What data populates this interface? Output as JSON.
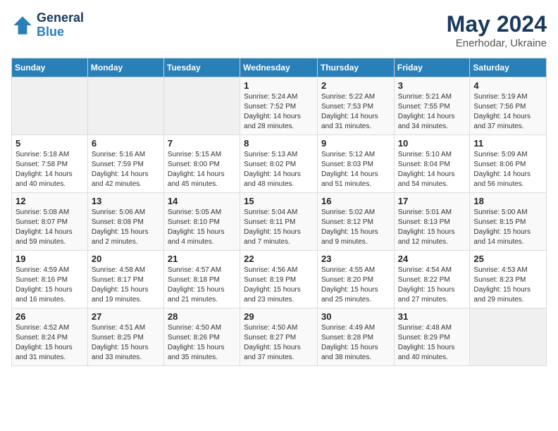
{
  "header": {
    "logo_line1": "General",
    "logo_line2": "Blue",
    "month": "May 2024",
    "location": "Enerhodar, Ukraine"
  },
  "weekdays": [
    "Sunday",
    "Monday",
    "Tuesday",
    "Wednesday",
    "Thursday",
    "Friday",
    "Saturday"
  ],
  "weeks": [
    [
      {
        "day": "",
        "info": ""
      },
      {
        "day": "",
        "info": ""
      },
      {
        "day": "",
        "info": ""
      },
      {
        "day": "1",
        "info": "Sunrise: 5:24 AM\nSunset: 7:52 PM\nDaylight: 14 hours and 28 minutes."
      },
      {
        "day": "2",
        "info": "Sunrise: 5:22 AM\nSunset: 7:53 PM\nDaylight: 14 hours and 31 minutes."
      },
      {
        "day": "3",
        "info": "Sunrise: 5:21 AM\nSunset: 7:55 PM\nDaylight: 14 hours and 34 minutes."
      },
      {
        "day": "4",
        "info": "Sunrise: 5:19 AM\nSunset: 7:56 PM\nDaylight: 14 hours and 37 minutes."
      }
    ],
    [
      {
        "day": "5",
        "info": "Sunrise: 5:18 AM\nSunset: 7:58 PM\nDaylight: 14 hours and 40 minutes."
      },
      {
        "day": "6",
        "info": "Sunrise: 5:16 AM\nSunset: 7:59 PM\nDaylight: 14 hours and 42 minutes."
      },
      {
        "day": "7",
        "info": "Sunrise: 5:15 AM\nSunset: 8:00 PM\nDaylight: 14 hours and 45 minutes."
      },
      {
        "day": "8",
        "info": "Sunrise: 5:13 AM\nSunset: 8:02 PM\nDaylight: 14 hours and 48 minutes."
      },
      {
        "day": "9",
        "info": "Sunrise: 5:12 AM\nSunset: 8:03 PM\nDaylight: 14 hours and 51 minutes."
      },
      {
        "day": "10",
        "info": "Sunrise: 5:10 AM\nSunset: 8:04 PM\nDaylight: 14 hours and 54 minutes."
      },
      {
        "day": "11",
        "info": "Sunrise: 5:09 AM\nSunset: 8:06 PM\nDaylight: 14 hours and 56 minutes."
      }
    ],
    [
      {
        "day": "12",
        "info": "Sunrise: 5:08 AM\nSunset: 8:07 PM\nDaylight: 14 hours and 59 minutes."
      },
      {
        "day": "13",
        "info": "Sunrise: 5:06 AM\nSunset: 8:08 PM\nDaylight: 15 hours and 2 minutes."
      },
      {
        "day": "14",
        "info": "Sunrise: 5:05 AM\nSunset: 8:10 PM\nDaylight: 15 hours and 4 minutes."
      },
      {
        "day": "15",
        "info": "Sunrise: 5:04 AM\nSunset: 8:11 PM\nDaylight: 15 hours and 7 minutes."
      },
      {
        "day": "16",
        "info": "Sunrise: 5:02 AM\nSunset: 8:12 PM\nDaylight: 15 hours and 9 minutes."
      },
      {
        "day": "17",
        "info": "Sunrise: 5:01 AM\nSunset: 8:13 PM\nDaylight: 15 hours and 12 minutes."
      },
      {
        "day": "18",
        "info": "Sunrise: 5:00 AM\nSunset: 8:15 PM\nDaylight: 15 hours and 14 minutes."
      }
    ],
    [
      {
        "day": "19",
        "info": "Sunrise: 4:59 AM\nSunset: 8:16 PM\nDaylight: 15 hours and 16 minutes."
      },
      {
        "day": "20",
        "info": "Sunrise: 4:58 AM\nSunset: 8:17 PM\nDaylight: 15 hours and 19 minutes."
      },
      {
        "day": "21",
        "info": "Sunrise: 4:57 AM\nSunset: 8:18 PM\nDaylight: 15 hours and 21 minutes."
      },
      {
        "day": "22",
        "info": "Sunrise: 4:56 AM\nSunset: 8:19 PM\nDaylight: 15 hours and 23 minutes."
      },
      {
        "day": "23",
        "info": "Sunrise: 4:55 AM\nSunset: 8:20 PM\nDaylight: 15 hours and 25 minutes."
      },
      {
        "day": "24",
        "info": "Sunrise: 4:54 AM\nSunset: 8:22 PM\nDaylight: 15 hours and 27 minutes."
      },
      {
        "day": "25",
        "info": "Sunrise: 4:53 AM\nSunset: 8:23 PM\nDaylight: 15 hours and 29 minutes."
      }
    ],
    [
      {
        "day": "26",
        "info": "Sunrise: 4:52 AM\nSunset: 8:24 PM\nDaylight: 15 hours and 31 minutes."
      },
      {
        "day": "27",
        "info": "Sunrise: 4:51 AM\nSunset: 8:25 PM\nDaylight: 15 hours and 33 minutes."
      },
      {
        "day": "28",
        "info": "Sunrise: 4:50 AM\nSunset: 8:26 PM\nDaylight: 15 hours and 35 minutes."
      },
      {
        "day": "29",
        "info": "Sunrise: 4:50 AM\nSunset: 8:27 PM\nDaylight: 15 hours and 37 minutes."
      },
      {
        "day": "30",
        "info": "Sunrise: 4:49 AM\nSunset: 8:28 PM\nDaylight: 15 hours and 38 minutes."
      },
      {
        "day": "31",
        "info": "Sunrise: 4:48 AM\nSunset: 8:29 PM\nDaylight: 15 hours and 40 minutes."
      },
      {
        "day": "",
        "info": ""
      }
    ]
  ]
}
